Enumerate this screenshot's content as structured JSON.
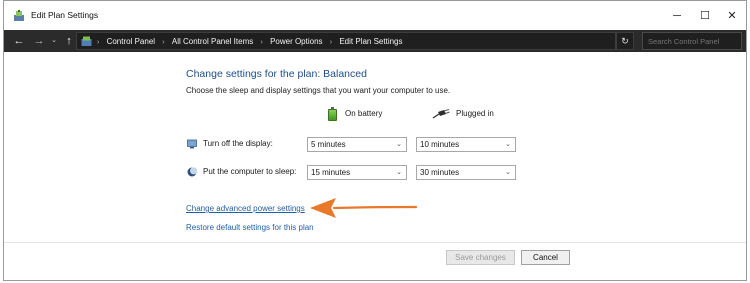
{
  "window": {
    "title": "Edit Plan Settings",
    "minimize_glyph": "─",
    "maximize_glyph": "☐",
    "close_glyph": "✕"
  },
  "address": {
    "back_glyph": "←",
    "forward_glyph": "→",
    "recent_glyph": "⌄",
    "up_glyph": "↑",
    "breadcrumbs": [
      "Control Panel",
      "All Control Panel Items",
      "Power Options",
      "Edit Plan Settings"
    ],
    "separator": "›",
    "dropdown_glyph": "⌄",
    "refresh_glyph": "↻",
    "search_placeholder": "Search Control Panel"
  },
  "main": {
    "heading": "Change settings for the plan: Balanced",
    "subtitle": "Choose the sleep and display settings that you want your computer to use.",
    "columns": {
      "battery": "On battery",
      "plugged": "Plugged in"
    },
    "rows": [
      {
        "label": "Turn off the display:",
        "battery": "5 minutes",
        "plugged": "10 minutes"
      },
      {
        "label": "Put the computer to sleep:",
        "battery": "15 minutes",
        "plugged": "30 minutes"
      }
    ],
    "select_caret": "⌄",
    "advanced_link": "Change advanced power settings",
    "restore_link": "Restore default settings for this plan"
  },
  "footer": {
    "save_label": "Save changes",
    "cancel_label": "Cancel"
  },
  "colors": {
    "heading": "#1e4e8c",
    "link": "#1f5fa8",
    "address_bar": "#2b2b2b",
    "arrow": "#e8792a"
  }
}
